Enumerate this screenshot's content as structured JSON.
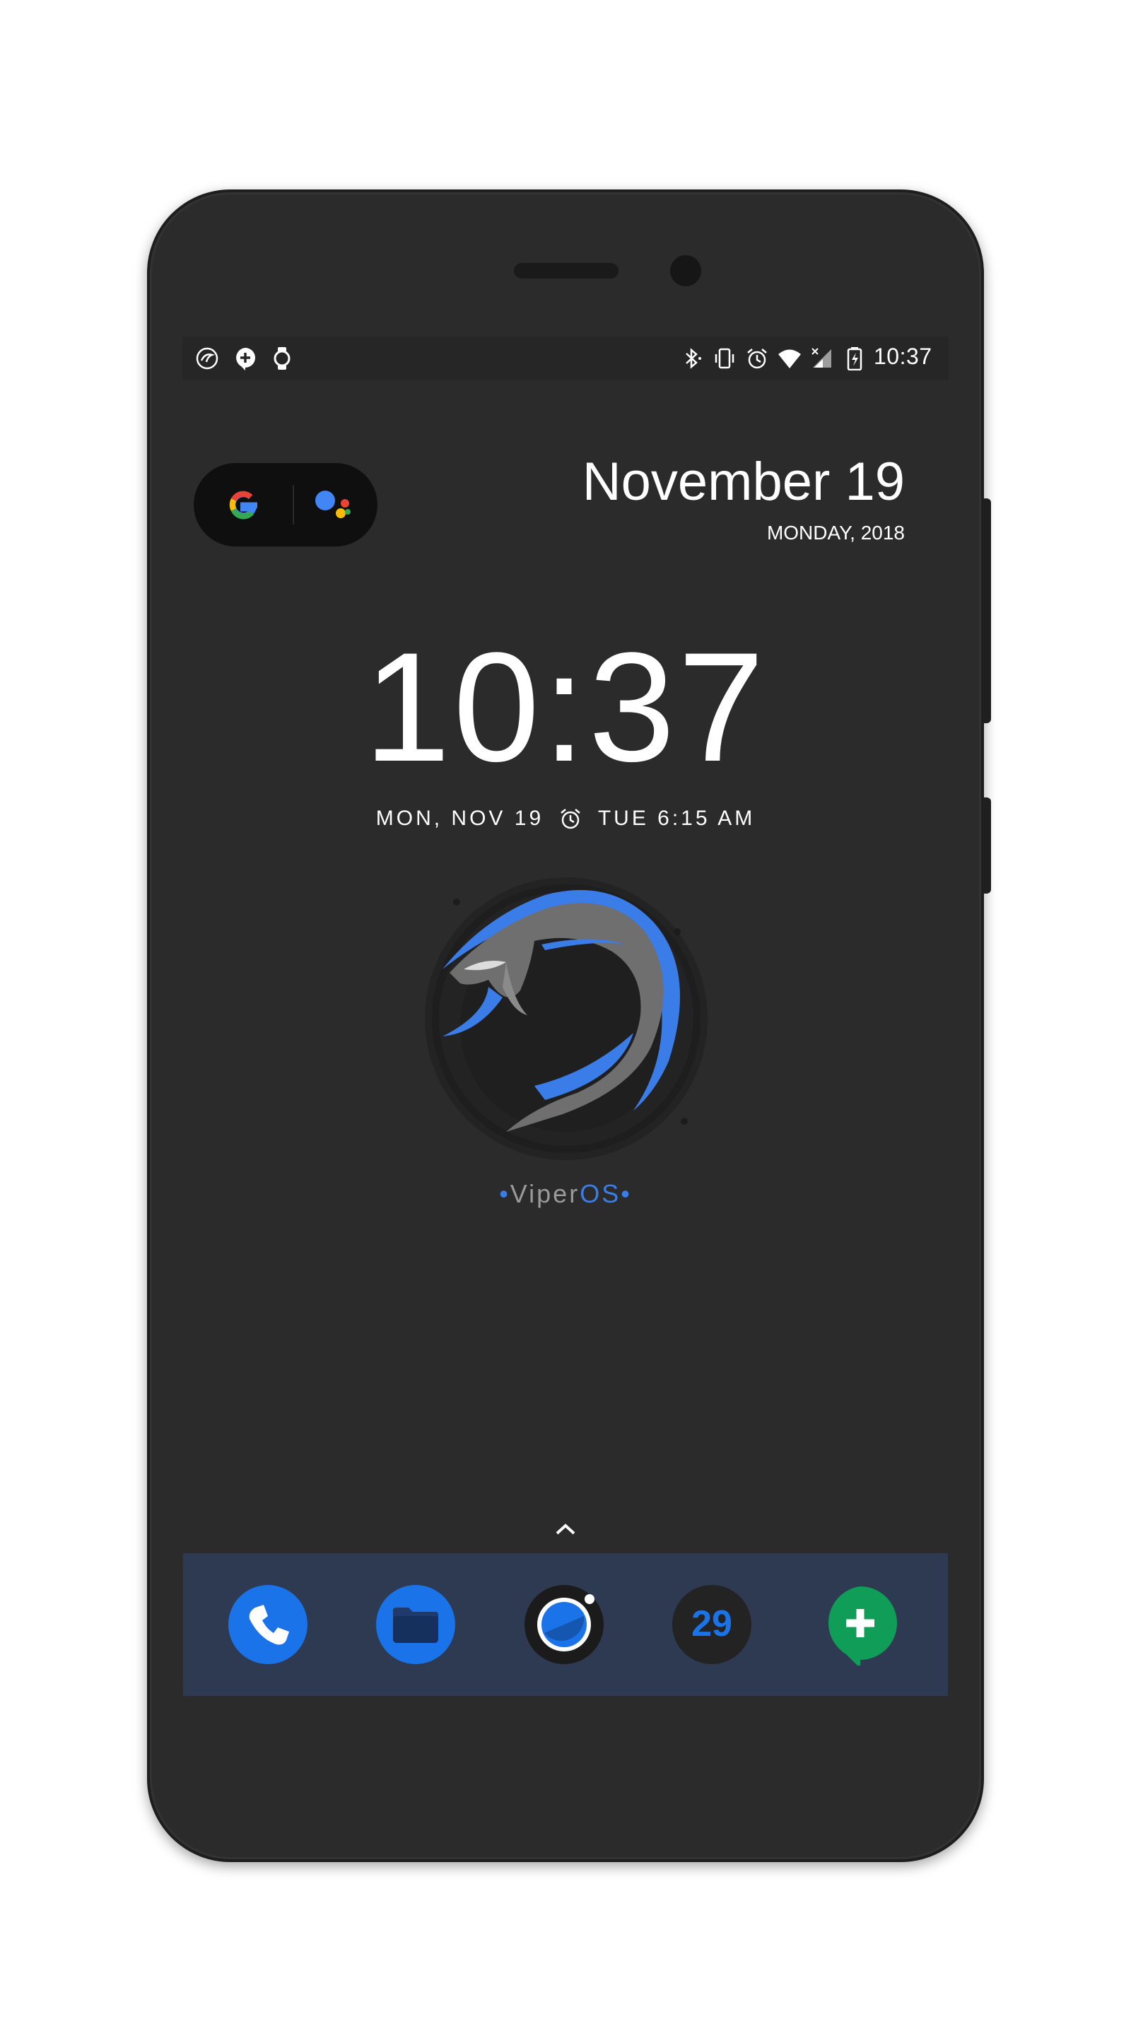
{
  "status_bar": {
    "left_icons": [
      "viper-notification-icon",
      "hangouts-notification-icon",
      "watch-icon"
    ],
    "right_icons": [
      "bluetooth-icon",
      "vibrate-icon",
      "alarm-icon",
      "wifi-icon",
      "cell-signal-icon",
      "battery-icon"
    ],
    "time": "10:37"
  },
  "search_widget": {
    "icons": [
      "google-icon",
      "assistant-icon"
    ]
  },
  "date_widget": {
    "date": "November 19",
    "weekday_year": "MONDAY, 2018"
  },
  "clock": {
    "time": "10:37",
    "date_line": "MON, NOV 19",
    "alarm_text": "TUE 6:15 AM"
  },
  "branding": {
    "dot_left": "•",
    "name_main": "Viper",
    "name_accent": "OS",
    "dot_right": "•"
  },
  "dock": {
    "apps": [
      {
        "name": "Phone",
        "icon": "phone-icon"
      },
      {
        "name": "Files",
        "icon": "folder-icon"
      },
      {
        "name": "Camera",
        "icon": "camera-icon"
      },
      {
        "name": "Calendar",
        "icon": "calendar-icon",
        "badge": "29"
      },
      {
        "name": "Hangouts",
        "icon": "hangouts-icon"
      }
    ]
  },
  "colors": {
    "accent_blue": "#3b7de8",
    "screen_bg": "#2b2b2b",
    "dock_bg": "#2d3a52",
    "hangouts_green": "#0f9d58"
  }
}
